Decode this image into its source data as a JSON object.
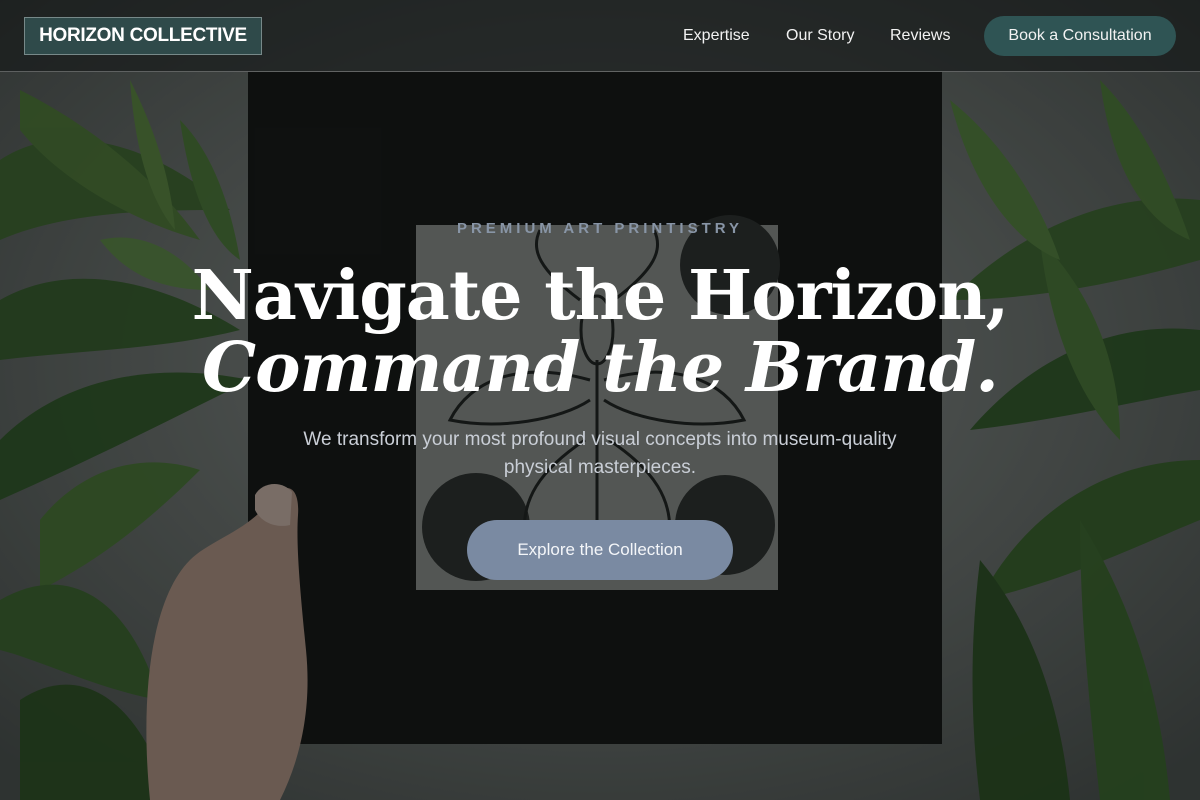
{
  "header": {
    "brand": "HORIZON COLLECTIVE",
    "nav": {
      "expertise": "Expertise",
      "our_story": "Our Story",
      "reviews": "Reviews"
    },
    "cta": "Book a Consultation"
  },
  "hero": {
    "eyebrow": "PREMIUM ART PRINTISTRY",
    "headline_line1": "Navigate the Horizon,",
    "headline_line2": "Command the Brand.",
    "subtext": "We transform your most profound visual concepts into museum-quality physical masterpieces.",
    "cta": "Explore the Collection"
  },
  "colors": {
    "brand_background": "#2f4a4a",
    "header_cta": "#2f5454",
    "hero_cta": "#7a8aa2",
    "eyebrow": "#8895a6"
  },
  "icons": {
    "background": "hand-holding-insect-print-photo"
  }
}
